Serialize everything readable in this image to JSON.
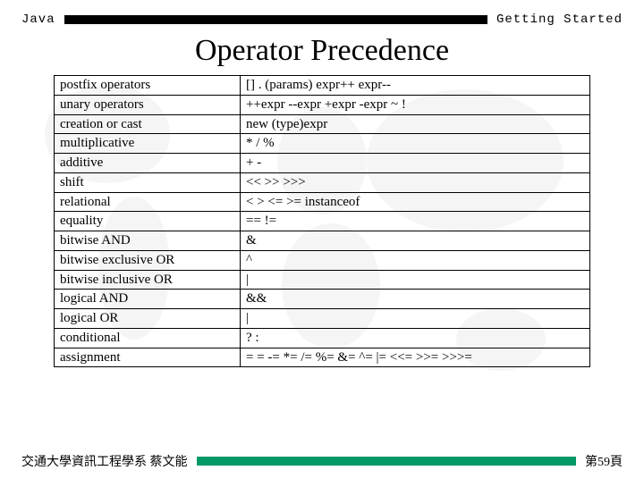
{
  "header": {
    "left": "Java",
    "right": "Getting Started"
  },
  "title": "Operator Precedence",
  "rows": [
    {
      "category": "postfix operators",
      "ops": "[]    .    (params)    expr++    expr--"
    },
    {
      "category": "unary operators",
      "ops": "++expr    --expr    +expr    -expr    ~    !"
    },
    {
      "category": "creation or cast",
      "ops": "new    (type)expr"
    },
    {
      "category": "multiplicative",
      "ops": "*    /    %"
    },
    {
      "category": "additive",
      "ops": "+    -"
    },
    {
      "category": "shift",
      "ops": "<<    >>        >>>"
    },
    {
      "category": "relational",
      "ops": "<    >    <=    >=        instanceof"
    },
    {
      "category": "equality",
      "ops": "==    !="
    },
    {
      "category": "bitwise AND",
      "ops": "&"
    },
    {
      "category": "bitwise exclusive OR",
      "ops": "^"
    },
    {
      "category": "bitwise inclusive OR",
      "ops": "|"
    },
    {
      "category": "logical AND",
      "ops": "&&"
    },
    {
      "category": "logical OR",
      "ops": "|"
    },
    {
      "category": "conditional",
      "ops": "? :"
    },
    {
      "category": "assignment",
      "ops": "=       =    -=    *=    /=    %=    &=    ^=    |=    <<=    >>=    >>>="
    }
  ],
  "footer": {
    "left": "交通大學資訊工程學系 蔡文能",
    "right": "第59頁"
  }
}
